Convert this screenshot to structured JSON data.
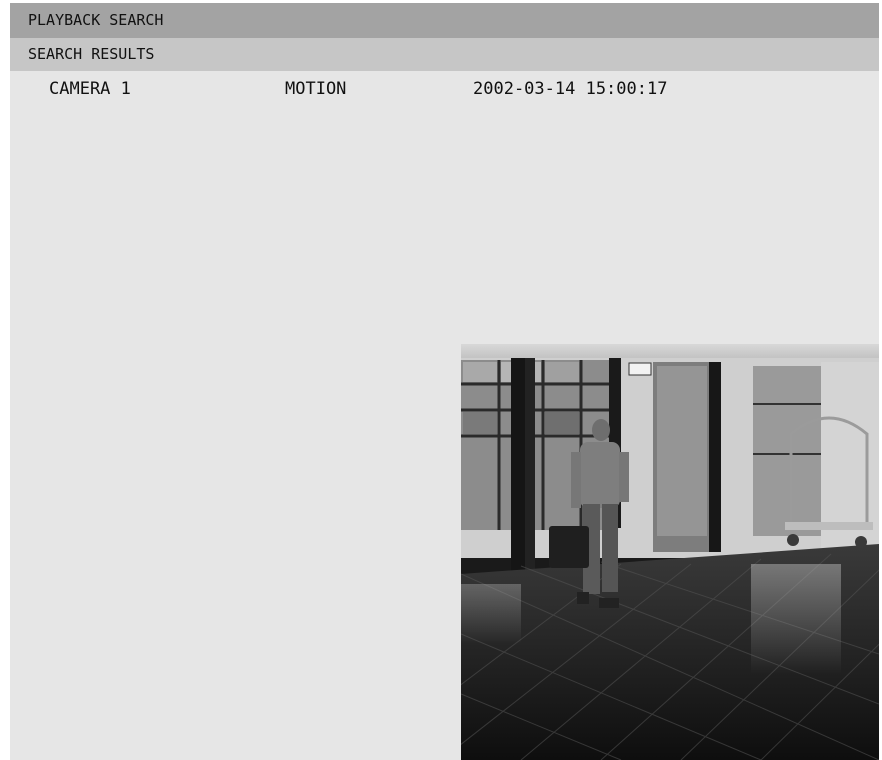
{
  "header": {
    "title": "PLAYBACK SEARCH"
  },
  "results": {
    "heading": "SEARCH RESULTS",
    "rows": [
      {
        "camera": "CAMERA 1",
        "event": "MOTION",
        "timestamp": "2002-03-14 15:00:17"
      }
    ]
  },
  "preview": {
    "subject": "camera-preview-image",
    "exit_sign": "exit-sign-icon"
  }
}
